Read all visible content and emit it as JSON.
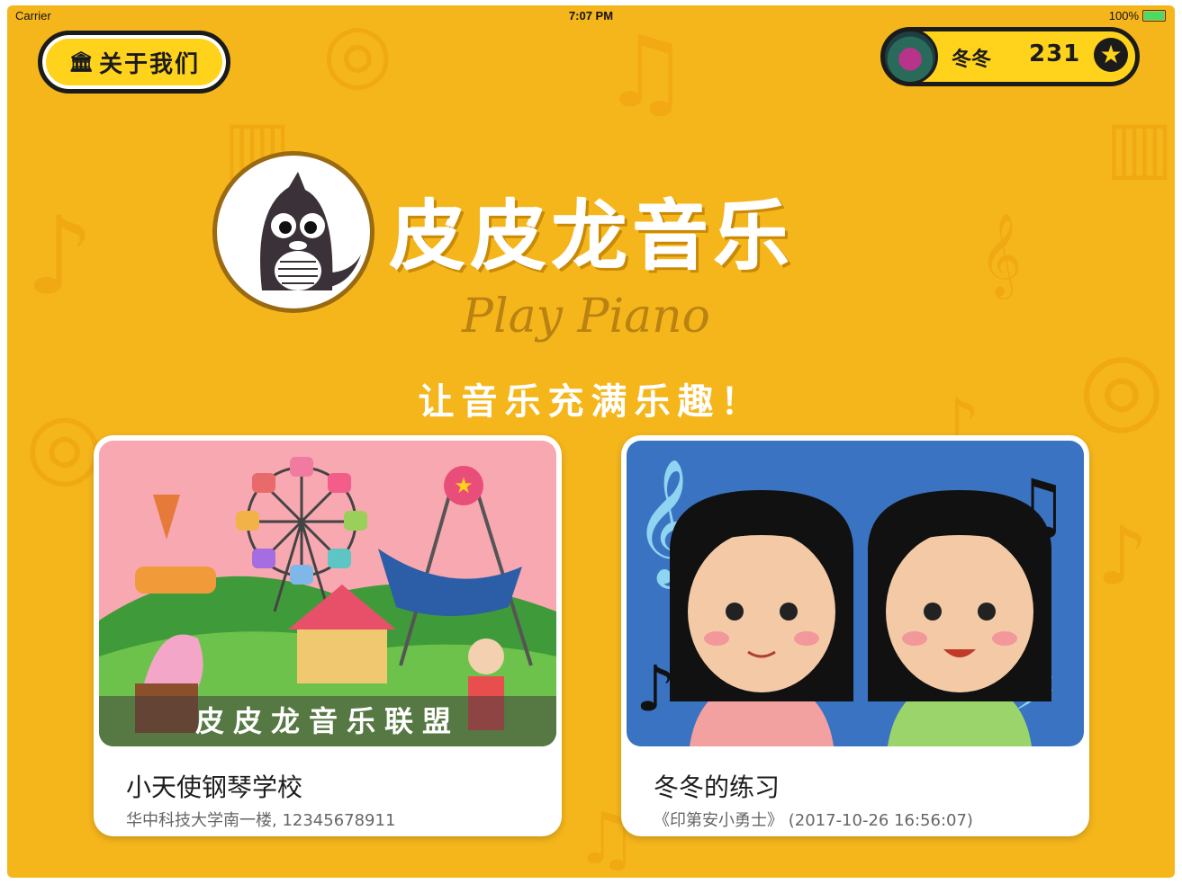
{
  "status_bar": {
    "carrier": "Carrier",
    "time": "7:07 PM",
    "battery": "100%"
  },
  "about_button": {
    "label": "关于我们",
    "icon": "bank-icon"
  },
  "user": {
    "name": "冬冬",
    "score": "231",
    "icon": "star-icon"
  },
  "brand": {
    "title": "皮皮龙音乐",
    "subtitle": "Play Piano",
    "slogan": "让音乐充满乐趣！"
  },
  "cards": [
    {
      "caption": "皮皮龙音乐联盟",
      "title": "小天使钢琴学校",
      "subtitle": "华中科技大学南一楼, 12345678911"
    },
    {
      "title": "冬冬的练习",
      "subtitle": "《印第安小勇士》 (2017-10-26 16:56:07)"
    }
  ],
  "colors": {
    "background": "#f5b61c",
    "button": "#ffd21c",
    "outline": "#1b1b1b"
  }
}
